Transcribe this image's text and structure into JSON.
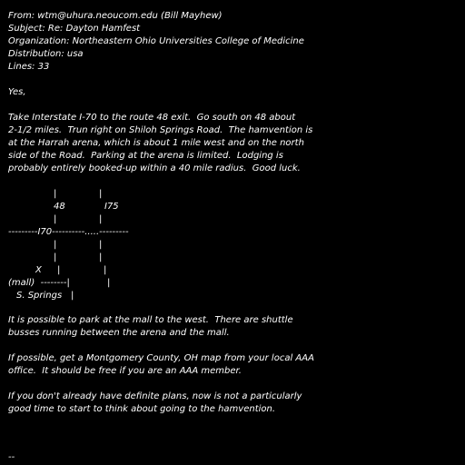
{
  "header": {
    "from": "From: wtm@uhura.neoucom.edu (Bill Mayhew)",
    "subject": "Subject: Re: Dayton Hamfest",
    "organization": "Organization: Northeastern Ohio Universities College of Medicine",
    "distribution": "Distribution: usa",
    "lines": "Lines: 33"
  },
  "body": {
    "greeting": "Yes,",
    "para1": [
      "Take Interstate I-70 to the route 48 exit.  Go south on 48 about",
      "2-1/2 miles.  Trun right on Shiloh Springs Road.  The hamvention is",
      "at the Harrah arena, which is about 1 mile west and on the north",
      "side of the Road.  Parking at the arena is limited.  Lodging is",
      "probably entirely booked-up within a 40 mile radius.  Good luck."
    ],
    "para2": [
      "It is possible to park at the mall to the west.  There are shuttle",
      "busses running between the arena and the mall."
    ],
    "para3": [
      "If possible, get a Montgomery County, OH map from your local AAA",
      "office.  It should be free if you are an AAA member."
    ],
    "para4": [
      "If you don't already have definite plans, now is not a particularly",
      "good time to start to think about going to the hamvention."
    ]
  },
  "map": {
    "bar": "|",
    "label_48": "48",
    "label_i75": "I75",
    "i70_line": "---------I70----------.....---------",
    "x_mark": "X",
    "mall_line": "(mall)  --------|",
    "springs": "S. Springs",
    "springs_bar": "|"
  },
  "footer": {
    "sig": "--"
  }
}
